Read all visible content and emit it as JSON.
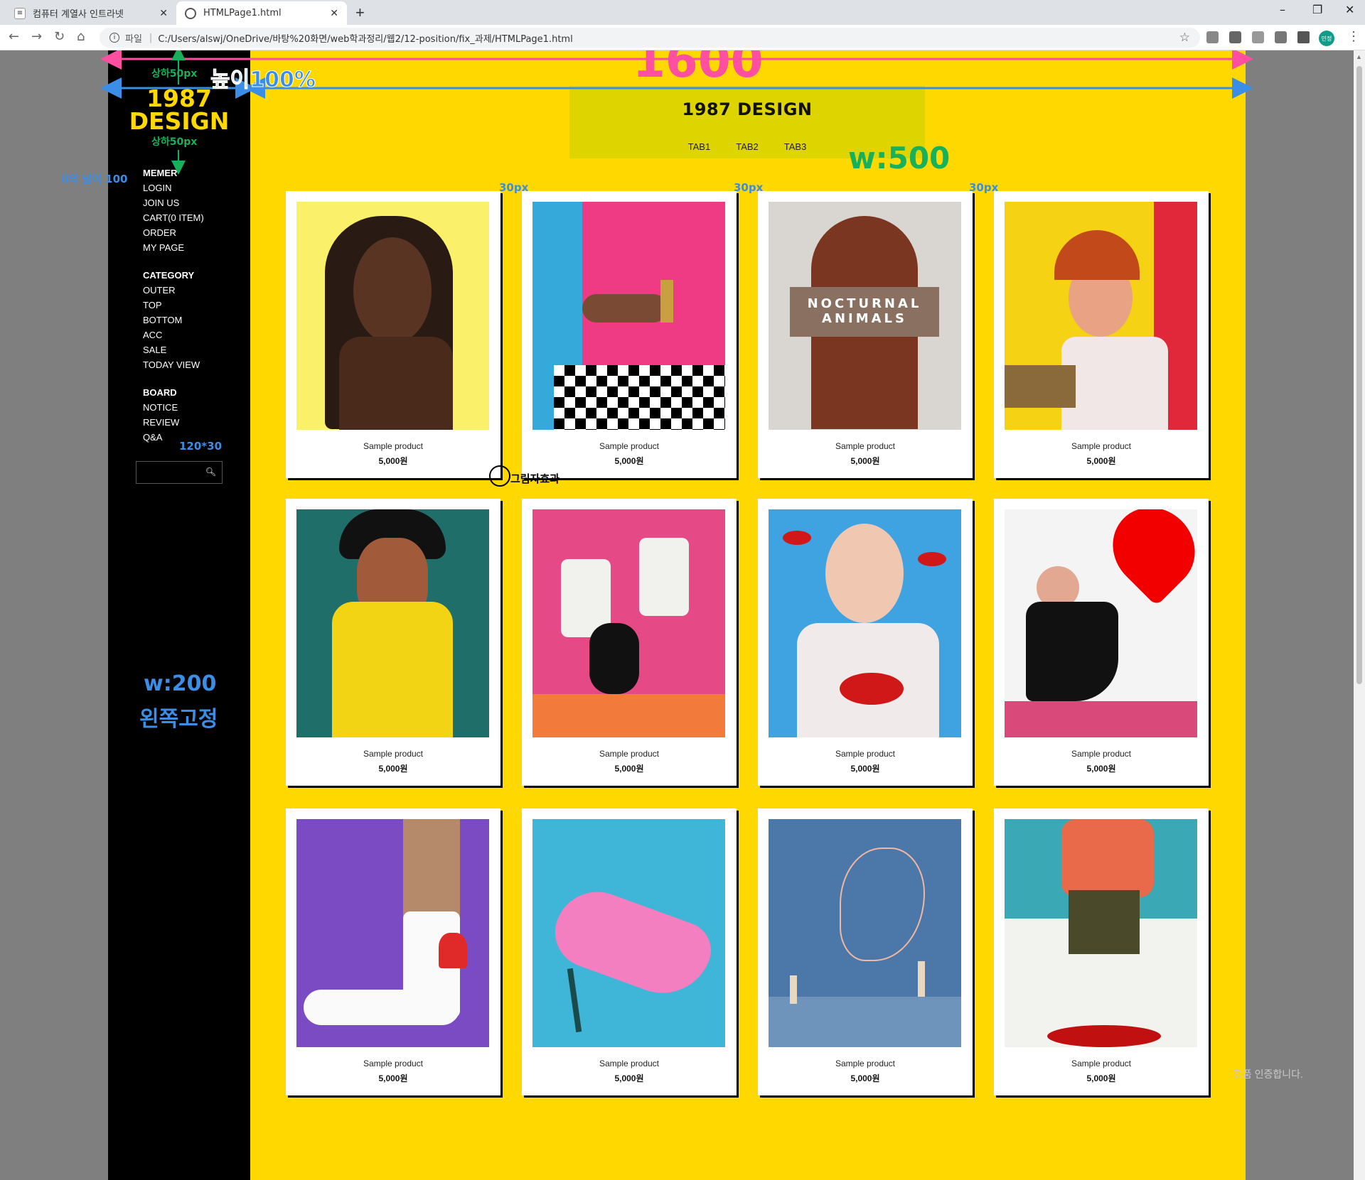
{
  "browser": {
    "tabs": [
      {
        "label": "컴퓨터 계열사 인트라넷",
        "active": false
      },
      {
        "label": "HTMLPage1.html",
        "active": true
      }
    ],
    "new_tab": "+",
    "close": "✕",
    "protocol_label": "파일",
    "address": "C:/Users/alswj/OneDrive/바탕%20화면/web학과정리/웹2/12-position/fix_과제/HTMLPage1.html",
    "profile_initials": "민정"
  },
  "sidebar": {
    "logo_line1": "1987",
    "logo_line2": "DESIGN",
    "groups": [
      {
        "heading": "MEMER",
        "items": [
          "LOGIN",
          "JOIN US",
          "CART(0 ITEM)",
          "ORDER",
          "MY PAGE"
        ]
      },
      {
        "heading": "CATEGORY",
        "items": [
          "OUTER",
          "TOP",
          "BOTTOM",
          "ACC",
          "SALE",
          "TODAY VIEW"
        ]
      },
      {
        "heading": "BOARD",
        "items": [
          "NOTICE",
          "REVIEW",
          "Q&A"
        ]
      }
    ],
    "search_placeholder": "",
    "search_icon": "search-icon"
  },
  "header": {
    "title": "1987 DESIGN",
    "tabs": [
      "TAB1",
      "TAB2",
      "TAB3"
    ]
  },
  "products": [
    {
      "name": "Sample product",
      "price": "5,000원",
      "image": "woman-portrait-yellow"
    },
    {
      "name": "Sample product",
      "price": "5,000원",
      "image": "hand-lipstick-chessboard"
    },
    {
      "name": "Sample product",
      "price": "5,000원",
      "image": "nocturnal-animals-poster"
    },
    {
      "name": "Sample product",
      "price": "5,000원",
      "image": "woman-kitchen-yellow"
    },
    {
      "name": "Sample product",
      "price": "5,000원",
      "image": "woman-yellow-coat"
    },
    {
      "name": "Sample product",
      "price": "5,000원",
      "image": "legs-white-boots-pink"
    },
    {
      "name": "Sample product",
      "price": "5,000원",
      "image": "lips-pattern-portrait"
    },
    {
      "name": "Sample product",
      "price": "5,000원",
      "image": "woman-red-heart"
    },
    {
      "name": "Sample product",
      "price": "5,000원",
      "image": "sock-purple"
    },
    {
      "name": "Sample product",
      "price": "5,000원",
      "image": "pink-sandal-blue"
    },
    {
      "name": "Sample product",
      "price": "5,000원",
      "image": "line-art-blue-wall"
    },
    {
      "name": "Sample product",
      "price": "5,000원",
      "image": "woman-kitchen-dance"
    }
  ],
  "annotations": {
    "width_total": "1600",
    "height_full": "높이100%",
    "pad_top": "상하50px",
    "pad_bottom": "상하50px",
    "li_width": "li의 넓이 100",
    "gap1": "30px",
    "gap2": "30px",
    "gap3": "30px",
    "header_width": "w:500",
    "search_size": "120*30",
    "shadow_effect": "그림자효과",
    "sidebar_width": "w:200",
    "sidebar_fixed": "왼쪽고정"
  },
  "watermark": "정품 인증합니다.",
  "colors": {
    "main_bg": "#ffd800",
    "header_bg": "#ded500",
    "sidebar_bg": "#000000",
    "logo": "#ffd800",
    "annot_pink": "#ff4fa0",
    "annot_blue": "#3a8ee6",
    "annot_green": "#18b05a"
  }
}
